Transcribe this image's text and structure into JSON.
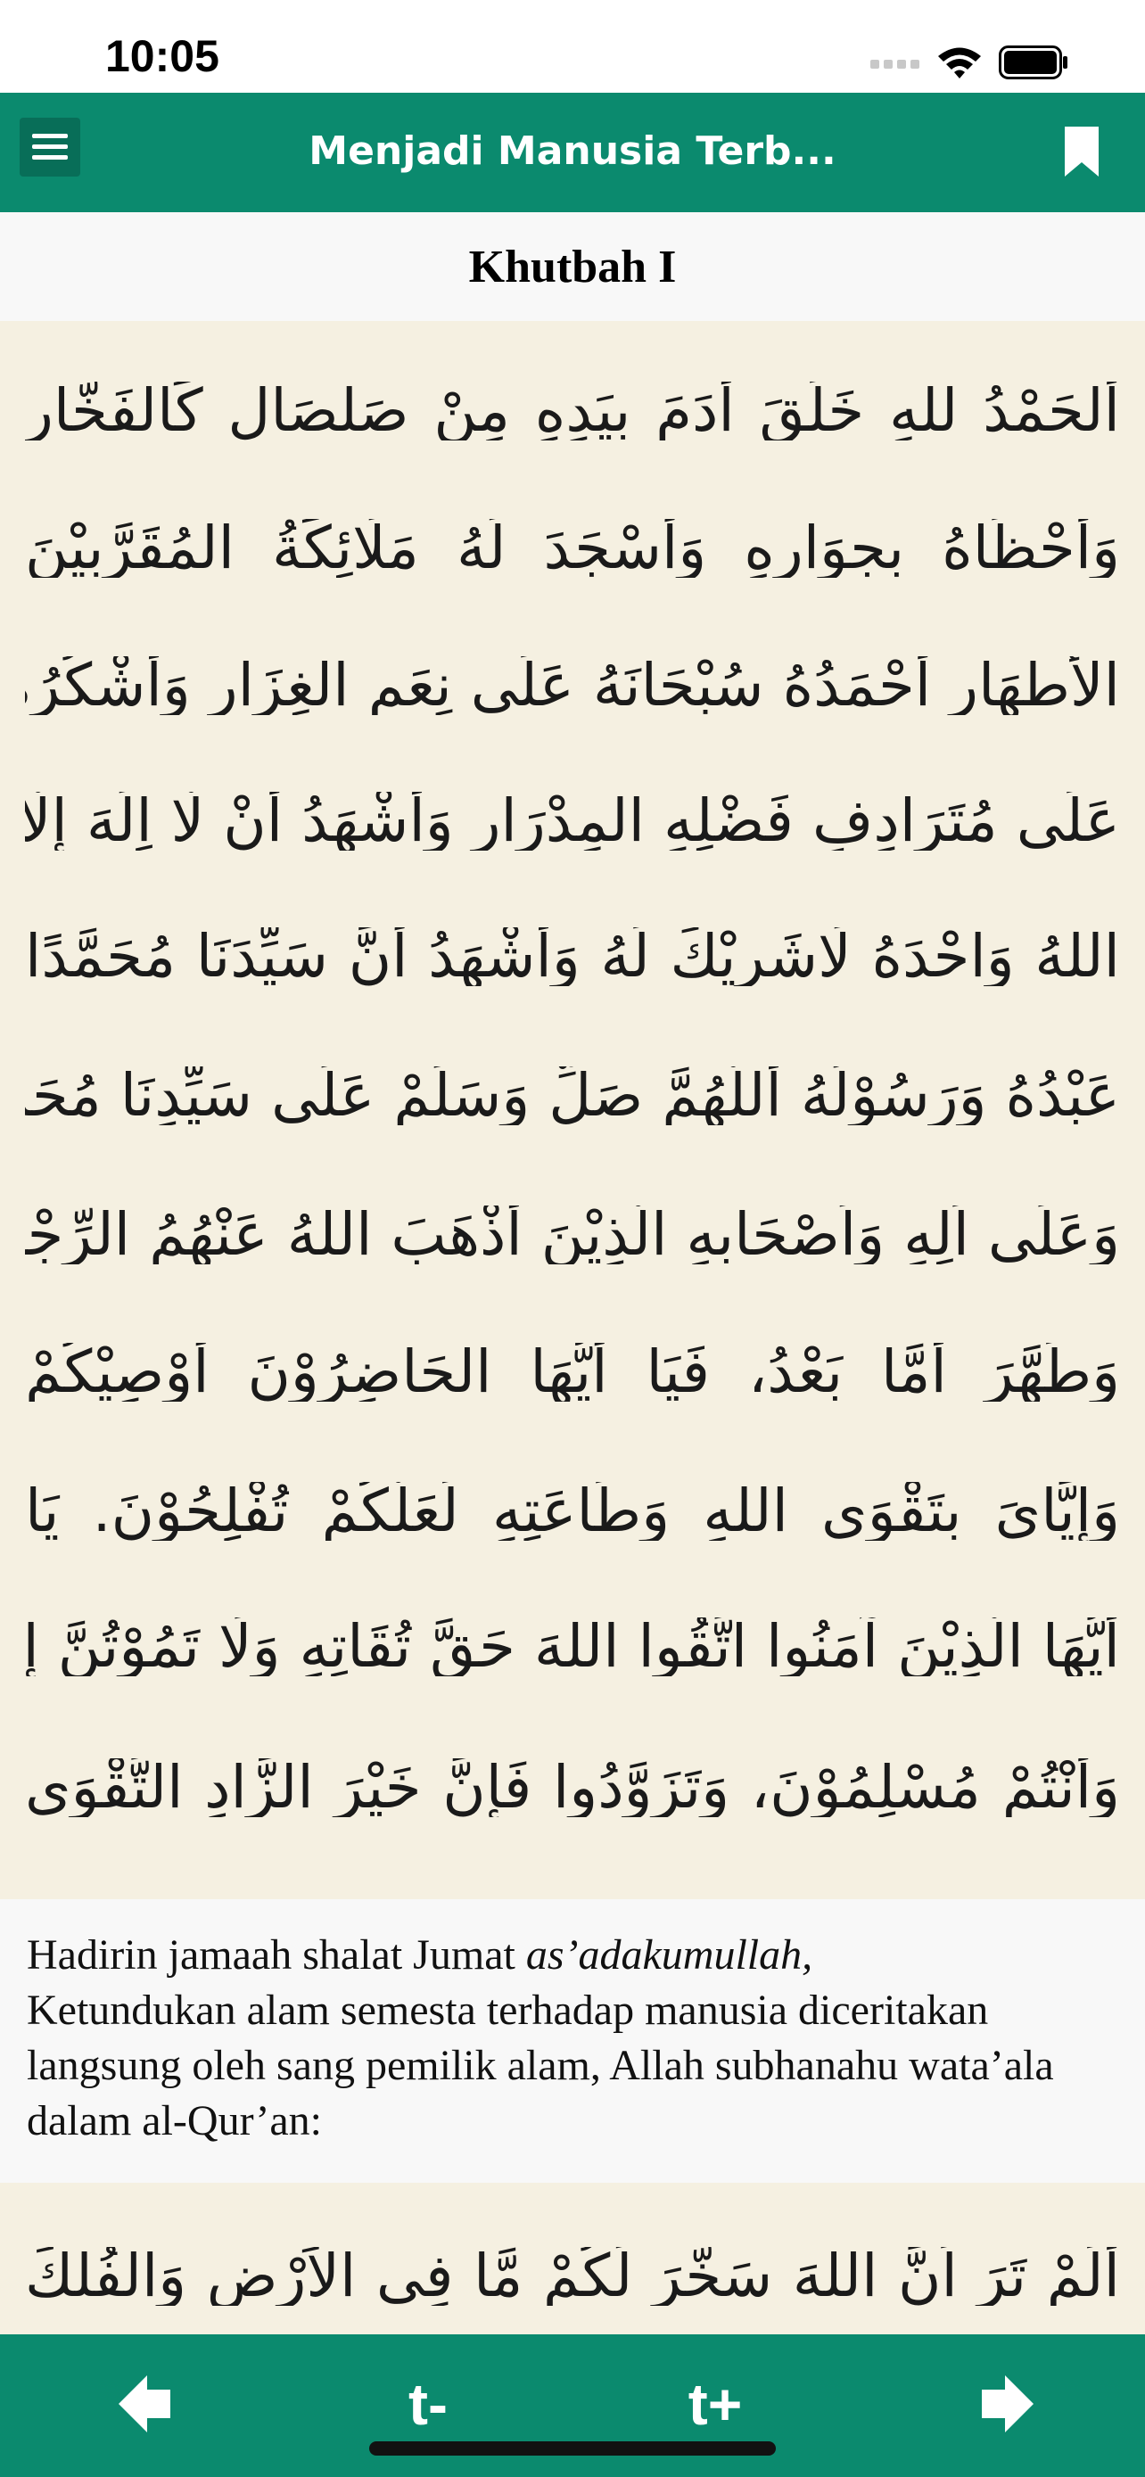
{
  "status_bar": {
    "time": "10:05"
  },
  "nav": {
    "title": "Menjadi Manusia Terb..."
  },
  "section": {
    "title": "Khutbah I"
  },
  "arabic_lines": [
    "أَلْحَمْدُ للهِ خَلَقَ أَدَمَ بِيَدِهِ مِنْ صَلْصَالٍ كَالْفَخَّارِ",
    "وَأَحْظَاهُ بِجِوَارِهِ وَأَسْجَدَ لَهُ مَلَائِكَةُ الْمُقَرَّبِيْنَ",
    "الْأَطْهَارِ أَحْمَدُهُ سُبْحَانَهُ عَلَى نِعَمِ الْغِزَارِ وَأَشْكُرُهُ",
    "عَلَى مُتَرَادِفِ فَضْلِهِ الْمِدْرَارِ وَأَشْهَدُ أَنْ لَّا اِلَهَ إِلَّا",
    "اللهُ وَاحْدَهُ لَاشَرِيْكَ لَهُ وَأَشْهَدُ أَنَّ سَيِّدَنَا مُحَمَّدًا",
    "عَبْدُهُ وَرَسُوْلُهُ أَللَّهُمَّ صَلِّ وَسَلِّمْ عَلَى سَيِّدِنَا مُحَمَّدٍ",
    "وَعَلَى اَلِهِ وَاَصْحَابِهِ الَّذِيْنَ أَذْهَبَ اللهُ عَنْهُمُ الرِّجْسَ",
    "وَطَهَّرَ أَمَّا بَعْدُ، فَيَا أَيُّهَا الْحَاضِرُوْنَ أُوْصِيْكُمْ",
    "وَإِيَّايَ بِتَقْوَى اللهِ وَطَاعَتِهِ لَعَلَّكُمْ تُفْلِحُوْنَ. يَا",
    "أَيُّهَا الَّذِيْنَ آمَنُوا اتَّقُوا اللهَ حَقَّ تُقَاتِهِ وَلَا تَمُوْتُنَّ إِلَّا",
    "وَأَنْتُمْ مُسْلِمُوْنَ، وَتَزَوَّدُوا فَإِنَّ خَيْرَ الزَّادِ التَّقْوَى"
  ],
  "translation": {
    "intro": "Hadirin jamaah shalat Jumat ",
    "intro_italic": "as’adakumullah,",
    "body": "Ketundukan alam semesta terhadap manusia diceritakan langsung oleh sang pemilik alam, Allah subhanahu wata’ala dalam al-Qur’an:"
  },
  "arabic_ayah": "أَلَمْ تَرَ اَنَّ اللهَ سَخَّرَ لَكُمْ مَّا فِى الْاَرْضِ وَالْفُلْكَ",
  "toolbar": {
    "prev": "previous-page",
    "text_smaller": "t-",
    "text_larger": "t+",
    "next": "next-page"
  },
  "colors": {
    "primary": "#0b8a6e",
    "arabic_bg": "#f5f0e1"
  },
  "icons": {
    "menu": "hamburger-menu-icon",
    "bookmark": "bookmark-icon",
    "prev": "arrow-left-icon",
    "next": "arrow-right-icon"
  }
}
